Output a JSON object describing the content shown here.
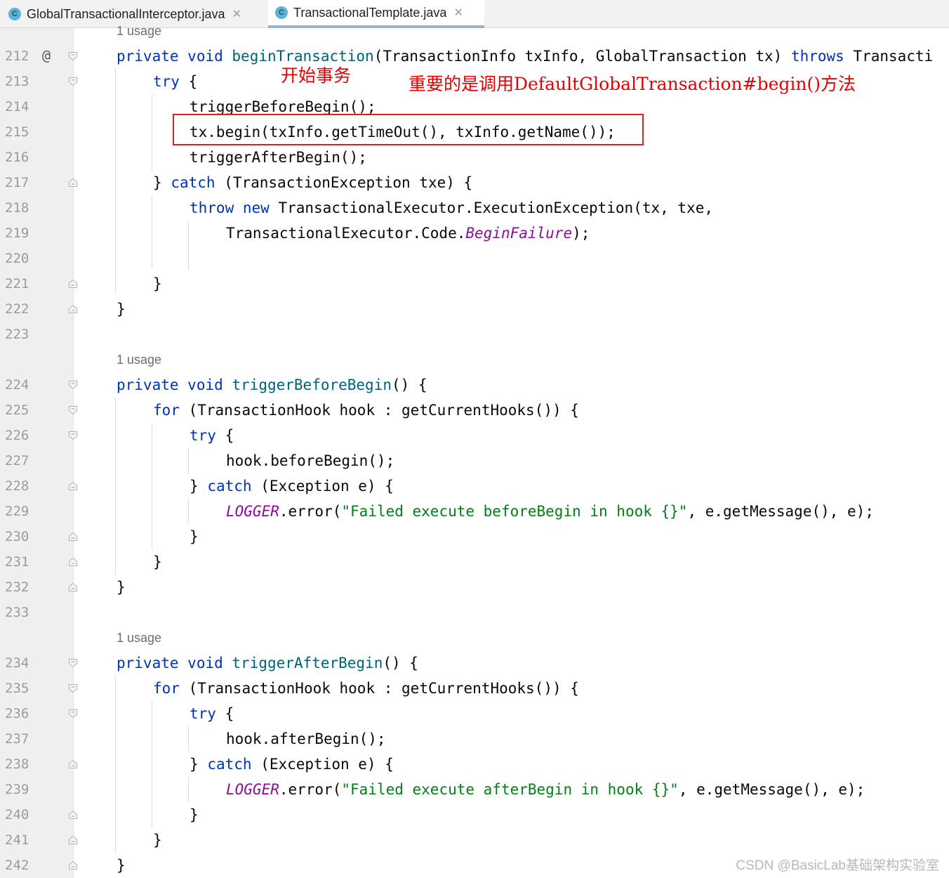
{
  "tabs": [
    {
      "label": "GlobalTransactionalInterceptor.java",
      "icon": "class-icon",
      "active": false
    },
    {
      "label": "TransactionalTemplate.java",
      "icon": "class-icon",
      "active": true
    }
  ],
  "line_numbers": [
    "212",
    "213",
    "214",
    "215",
    "216",
    "217",
    "218",
    "219",
    "220",
    "221",
    "222",
    "223",
    "224",
    "225",
    "226",
    "227",
    "228",
    "229",
    "230",
    "231",
    "232",
    "233",
    "234",
    "235",
    "236",
    "237",
    "238",
    "239",
    "240",
    "241",
    "242"
  ],
  "gutter_marker": "@",
  "usages": [
    "1 usage",
    "1 usage",
    "1 usage"
  ],
  "code": {
    "l212": {
      "kw1": "private",
      "kw2": "void",
      "fn": "beginTransaction",
      "rest": "(TransactionInfo txInfo, GlobalTransaction tx)",
      "kw3": "throws",
      "tail": "Transacti"
    },
    "l213": {
      "kw": "try",
      "rest": "{"
    },
    "l214": "triggerBeforeBegin();",
    "l215": "tx.begin(txInfo.getTimeOut(), txInfo.getName());",
    "l216": "triggerAfterBegin();",
    "l217": {
      "pre": "}",
      "kw": "catch",
      "rest": "(TransactionException txe) {"
    },
    "l218": {
      "kw1": "throw",
      "kw2": "new",
      "rest": "TransactionalExecutor.ExecutionException(tx, txe,"
    },
    "l219": {
      "pre": "TransactionalExecutor.Code.",
      "ital": "BeginFailure",
      "rest": ");"
    },
    "l221": "}",
    "l222": "}",
    "l224": {
      "kw1": "private",
      "kw2": "void",
      "fn": "triggerBeforeBegin",
      "rest": "() {"
    },
    "l225": {
      "kw": "for",
      "rest": "(TransactionHook hook : getCurrentHooks()) {"
    },
    "l226": {
      "kw": "try",
      "rest": "{"
    },
    "l227": "hook.beforeBegin();",
    "l228": {
      "pre": "}",
      "kw": "catch",
      "rest": "(Exception e) {"
    },
    "l229": {
      "ital": "LOGGER",
      "mid": ".error(",
      "str": "\"Failed execute beforeBegin in hook {}\"",
      "rest": ", e.getMessage(), e);"
    },
    "l230": "}",
    "l231": "}",
    "l232": "}",
    "l234": {
      "kw1": "private",
      "kw2": "void",
      "fn": "triggerAfterBegin",
      "rest": "() {"
    },
    "l235": {
      "kw": "for",
      "rest": "(TransactionHook hook : getCurrentHooks()) {"
    },
    "l236": {
      "kw": "try",
      "rest": "{"
    },
    "l237": "hook.afterBegin();",
    "l238": {
      "pre": "}",
      "kw": "catch",
      "rest": "(Exception e) {"
    },
    "l239": {
      "ital": "LOGGER",
      "mid": ".error(",
      "str": "\"Failed execute afterBegin in hook {}\"",
      "rest": ", e.getMessage(), e);"
    },
    "l240": "}",
    "l241": "}",
    "l242": "}"
  },
  "annotations": {
    "start_tx": "开始事务",
    "important": "重要的是调用DefaultGlobalTransaction#begin()方法"
  },
  "watermark": "CSDN @BasicLab基础架构实验室",
  "colors": {
    "keyword": "#0033b3",
    "method": "#00627a",
    "string": "#067d17",
    "static": "#871094",
    "annotation": "#e60000"
  }
}
